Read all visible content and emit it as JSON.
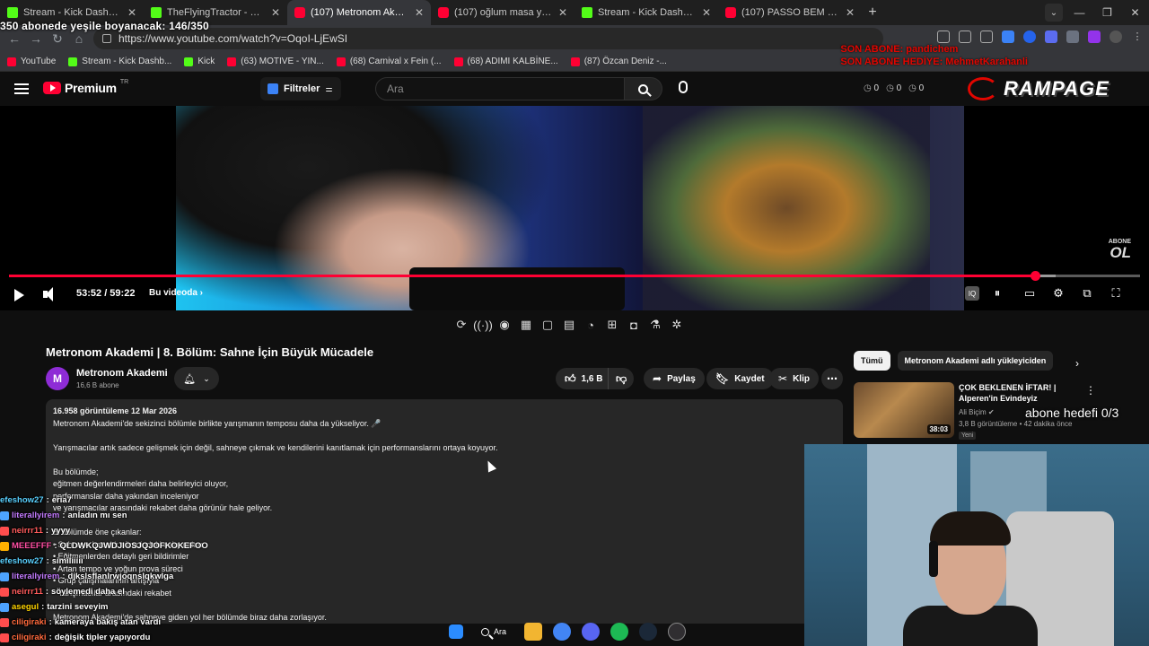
{
  "browser": {
    "tabs": [
      {
        "title": "Stream - Kick Dashboard",
        "favicon": "kick-icon",
        "active": false
      },
      {
        "title": "TheFlyingTractor - Watch clips a",
        "favicon": "kick-icon",
        "active": false
      },
      {
        "title": "(107) Metronom Akademi | 8. B",
        "favicon": "youtube-icon",
        "active": true
      },
      {
        "title": "(107) oğlum masa yirmibeşin s",
        "favicon": "youtube-icon",
        "active": false
      },
      {
        "title": "Stream - Kick Dashboard",
        "favicon": "kick-icon",
        "active": false
      },
      {
        "title": "(107) PASSO BEM SOLTO (ULTR",
        "favicon": "youtube-icon",
        "active": false
      }
    ],
    "url": "https://www.youtube.com/watch?v=OqoI-LjEwSI",
    "bookmarks": [
      {
        "label": "YouTube",
        "favicon": "youtube-icon"
      },
      {
        "label": "Stream - Kick Dashb...",
        "favicon": "kick-icon"
      },
      {
        "label": "Kick",
        "favicon": "kick-icon"
      },
      {
        "label": "(63) MOTIVE - YIN...",
        "favicon": "youtube-icon"
      },
      {
        "label": "(68) Carnival x Fein (...",
        "favicon": "youtube-icon"
      },
      {
        "label": "(68) ADIMI KALBİNE...",
        "favicon": "youtube-icon"
      },
      {
        "label": "(87) Özcan Deniz -...",
        "favicon": "youtube-icon"
      }
    ]
  },
  "stream_overlay": {
    "sub_goal_text": "350 abonede yeşile boyanacak: 146/350",
    "last_sub_line1": "SON ABONE: pandichem",
    "last_sub_line2": "SON ABONE HEDİYE: MehmetKarahanli",
    "abone_goal": "abone hedefi 0/3",
    "brand": "RAMPAGE",
    "abone_ol_small": "ABONE",
    "abone_ol_big": "OL"
  },
  "youtube": {
    "logo_text": "Premium",
    "logo_tm": "TR",
    "filter_label": "Filtreler",
    "search_placeholder": "Ara",
    "counters": [
      "0",
      "0",
      "0"
    ]
  },
  "player": {
    "time_current": "53:52",
    "time_total": "59:22",
    "time_display": "53:52 / 59:22",
    "chapter_label": "Bu videoda",
    "progress_fraction": 0.907,
    "buffered_fraction": 0.925
  },
  "video": {
    "title": "Metronom Akademi | 8. Bölüm: Sahne İçin Büyük Mücadele",
    "channel": "Metronom Akademi",
    "channel_initial": "M",
    "subscribers": "16,6 B abone",
    "likes": "1,6 B",
    "share_label": "Paylaş",
    "save_label": "Kaydet",
    "clip_label": "Klip",
    "views_date": "16.958 görüntüleme  12 Mar 2026",
    "description_lines": [
      "Metronom Akademi'de sekizinci bölümle birlikte yarışmanın temposu daha da yükseliyor. 🎤",
      "",
      "Yarışmacılar artık sadece gelişmek için değil, sahneye çıkmak ve kendilerini kanıtlamak için performanslarını ortaya koyuyor.",
      "",
      "Bu bölümde;",
      "eğitmen değerlendirmeleri daha belirleyici oluyor,",
      "performanslar daha yakından inceleniyor",
      "ve yarışmacılar arasındaki rekabet daha görünür hale geliyor.",
      "",
      "8. bölümde öne çıkanlar:",
      "• Sahneye hazırlık sürecindeki çalışmaları",
      "• Eğitmenlerden detaylı geri bildirimler",
      "• Artan tempo ve yoğun prova süreci",
      "• Grup çalışmalarının artışıyla",
      "• Yarışmacılar arasındaki rekabet",
      "",
      "Metronom Akademi'de sahneye giden yol her bölümde biraz daha zorlaşıyor."
    ]
  },
  "sidebar": {
    "chips": [
      "Tümü",
      "Metronom Akademi adlı yükleyiciden"
    ],
    "recommendation": {
      "title": "ÇOK BEKLENEN İFTAR! | Alperen'in Evindeyiz",
      "channel": "Ali Biçim",
      "meta": "3,8 B görüntüleme • 42 dakika önce",
      "badge": "Yeni",
      "duration": "38:03"
    }
  },
  "chat": [
    {
      "user": "efeshow27",
      "msg": "eria7",
      "color": "#5ad1ff",
      "badge": ""
    },
    {
      "user": "literallyirem",
      "msg": "anladın mı sen",
      "color": "#c47bff",
      "badge": "#4da3ff"
    },
    {
      "user": "neirrr11",
      "msg": "yyyy",
      "color": "#ff5c5c",
      "badge": "#ff4d4d"
    },
    {
      "user": "MEEEFFF",
      "msg": "QLDWKQJWDJIOSJQJOFKOKEFOO",
      "color": "#ff4fa3",
      "badge": "#ffb000"
    },
    {
      "user": "efeshow27",
      "msg": "similiiiii",
      "color": "#5ad1ff",
      "badge": ""
    },
    {
      "user": "literallyirem",
      "msg": "djkslsflanlrwjoqnslqkwlga",
      "color": "#c47bff",
      "badge": "#4da3ff"
    },
    {
      "user": "neirrr11",
      "msg": "söylemedi daha el",
      "color": "#ff5c5c",
      "badge": "#ff4d4d"
    },
    {
      "user": "asegul",
      "msg": "tarzini seveyim",
      "color": "#ffd400",
      "badge": "#4da3ff"
    },
    {
      "user": "ciligiraki",
      "msg": "kameraya bakış atan vardı",
      "color": "#ff6a3d",
      "badge": "#ff4d4d"
    },
    {
      "user": "ciligiraki",
      "msg": "değişik tipler yapıyordu",
      "color": "#ff6a3d",
      "badge": "#ff4d4d"
    }
  ],
  "taskbar": {
    "search_label": "Ara"
  }
}
